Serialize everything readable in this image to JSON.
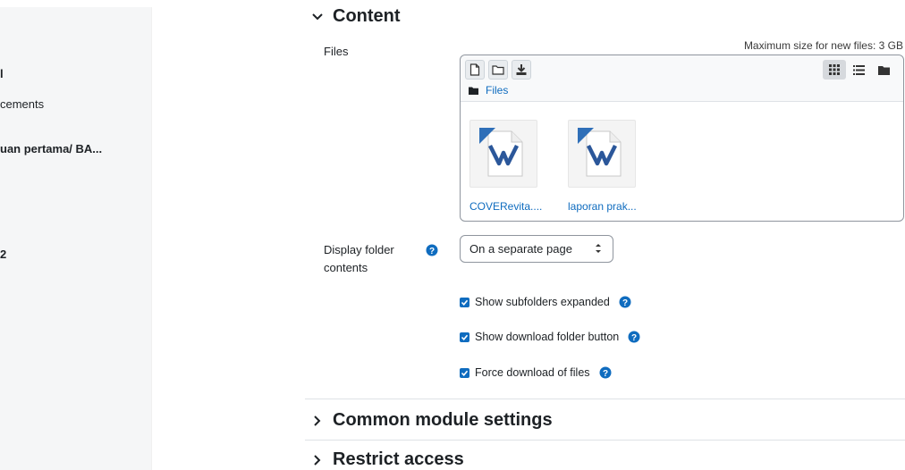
{
  "sidebar": {
    "items": [
      {
        "label": "l"
      },
      {
        "label": "cements"
      },
      {
        "label": "uan pertama/ BA..."
      },
      {
        "label": "2"
      }
    ]
  },
  "content_section": {
    "title": "Content",
    "files_label": "Files",
    "max_size": "Maximum size for new files: 3 GB",
    "path_label": "Files",
    "files": [
      {
        "name": "COVERevita...."
      },
      {
        "name": "laporan prak..."
      }
    ],
    "display_label_line1": "Display folder",
    "display_label_line2": "contents",
    "display_value": "On a separate page",
    "checkboxes": [
      {
        "label": "Show subfolders expanded",
        "checked": true
      },
      {
        "label": "Show download folder button",
        "checked": true
      },
      {
        "label": "Force download of files",
        "checked": true
      }
    ]
  },
  "sections": [
    {
      "title": "Common module settings"
    },
    {
      "title": "Restrict access"
    }
  ],
  "colors": {
    "link": "#0f6cbf",
    "help": "#0f6cbf",
    "checkbox": "#0f6cbf"
  },
  "icons": [
    "add-file-icon",
    "create-folder-icon",
    "download-icon",
    "grid-view-icon",
    "list-view-icon",
    "tree-view-icon",
    "folder-icon",
    "word-document-icon",
    "help-icon",
    "chevron-down-icon",
    "chevron-right-icon",
    "select-arrows-icon",
    "checkmark-icon"
  ]
}
